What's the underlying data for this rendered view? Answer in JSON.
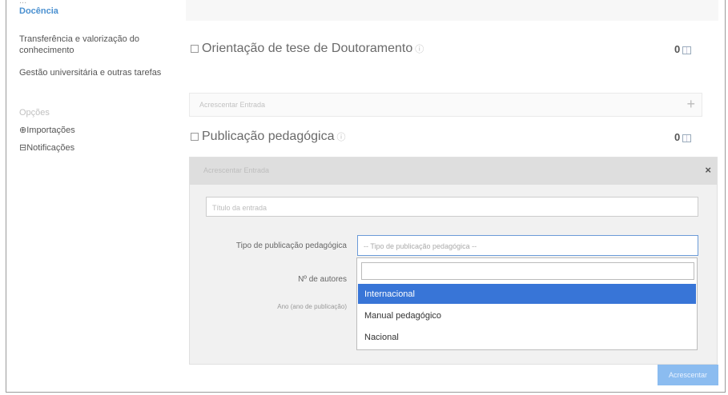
{
  "sidebar": {
    "cut_item": "...",
    "active_item": "Docência",
    "items": [
      {
        "label": "Transferência e valorização do conhecimento"
      },
      {
        "label": "Gestão universitária e outras tarefas"
      }
    ],
    "options_header": "Opções",
    "options": [
      {
        "label": "Importações",
        "icon": "globe-icon"
      },
      {
        "label": "Notificações",
        "icon": "inbox-icon"
      }
    ]
  },
  "sections": {
    "thesis": {
      "title": "Orientação de tese de Doutoramento",
      "count": "0",
      "add_label": "Acrescentar Entrada",
      "add_icon": "+"
    },
    "pub": {
      "title": "Publicação pedagógica",
      "count": "0"
    }
  },
  "form": {
    "header_label": "Acrescentar Entrada",
    "close_icon": "×",
    "title_placeholder": "Título da entrada",
    "type_label": "Tipo de publicação pedagógica",
    "type_placeholder": "-- Tipo de publicação pedagógica --",
    "authors_label": "Nº de autores",
    "year_label": "Ano (ano de publicação)",
    "options": [
      "Internacional",
      "Manual pedagógico",
      "Nacional"
    ],
    "selected_option": "Internacional",
    "submit_label": "Acrescentar"
  },
  "colors": {
    "accent": "#4a90d0",
    "selected": "#3875d7",
    "submit": "#8bbcf0"
  }
}
